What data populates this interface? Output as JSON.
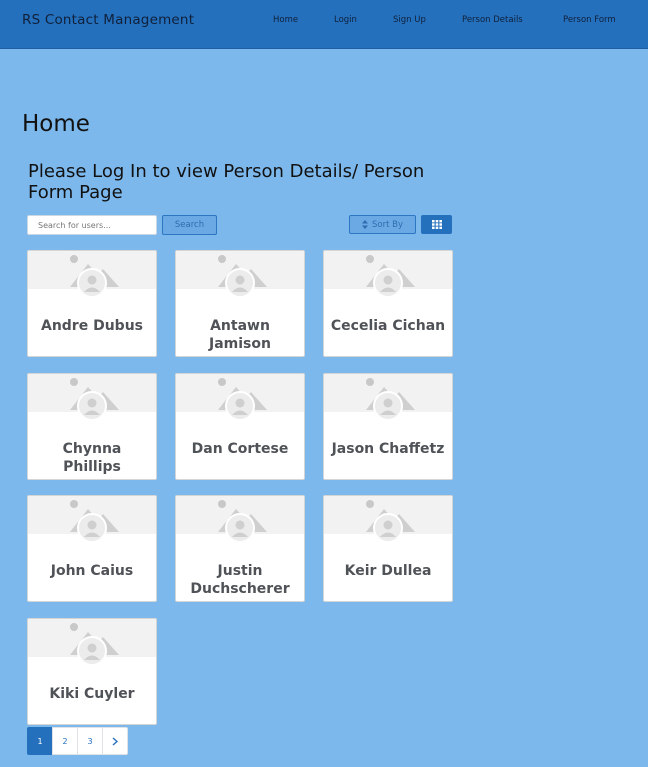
{
  "nav": {
    "brand": "RS Contact Management",
    "links": [
      "Home",
      "Login",
      "Sign Up",
      "Person Details",
      "Person Form"
    ]
  },
  "main": {
    "title": "Home",
    "subtitle": "Please Log In to view Person Details/ Person Form Page"
  },
  "toolbar": {
    "search_placeholder": "Search for users...",
    "search_label": "Search",
    "sort_label": "Sort By",
    "sort_icon": "sort-icon",
    "grid_icon": "grid-view-icon"
  },
  "people": [
    {
      "name": "Andre Dubus"
    },
    {
      "name": "Antawn Jamison"
    },
    {
      "name": "Cecelia Cichan"
    },
    {
      "name": "Chynna Phillips"
    },
    {
      "name": "Dan Cortese"
    },
    {
      "name": "Jason Chaffetz"
    },
    {
      "name": "John Caius"
    },
    {
      "name": "Justin Duchscherer"
    },
    {
      "name": "Keir Dullea"
    },
    {
      "name": "Kiki Cuyler"
    }
  ],
  "pagination": {
    "pages": [
      "1",
      "2",
      "3"
    ],
    "current": "1",
    "next_icon": "chevron-right-icon"
  },
  "colors": {
    "navbar": "#2470bd",
    "background": "#7db8ec",
    "accent": "#2470bd"
  }
}
